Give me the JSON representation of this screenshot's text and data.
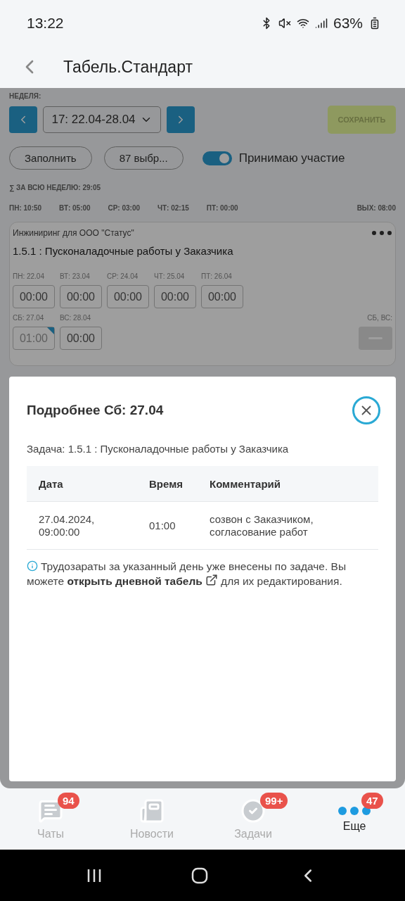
{
  "status_bar": {
    "time": "13:22",
    "battery": "63%"
  },
  "header": {
    "title": "Табель.Стандарт"
  },
  "week": {
    "label": "НЕДЕЛЯ:",
    "selector": "17: 22.04-28.04",
    "save": {
      "label": "СОХРАНИТЬ",
      "disabled": true
    }
  },
  "actions": {
    "fill": "Заполнить",
    "selection": "87 выбр...",
    "toggle": {
      "label": "Принимаю участие",
      "on": true
    }
  },
  "summary": {
    "total": "∑ ЗА ВСЮ НЕДЕЛЮ: 29:05",
    "days": [
      "ПН: 10:50",
      "ВТ: 05:00",
      "СР: 03:00",
      "ЧТ: 02:15",
      "ПТ: 00:00"
    ],
    "weekend": "ВЫХ: 08:00"
  },
  "task_card": {
    "project": "Инжиниринг для ООО \"Статус\"",
    "task": "1.5.1 : Пусконаладочные работы у Заказчика",
    "weekdays": [
      {
        "label": "ПН: 22.04",
        "value": "00:00",
        "commented": false
      },
      {
        "label": "ВТ: 23.04",
        "value": "00:00",
        "commented": false
      },
      {
        "label": "СР: 24.04",
        "value": "00:00",
        "commented": false
      },
      {
        "label": "ЧТ: 25.04",
        "value": "00:00",
        "commented": false
      },
      {
        "label": "ПТ: 26.04",
        "value": "00:00",
        "commented": false
      }
    ],
    "weekend_days": [
      {
        "label": "СБ: 27.04",
        "value": "01:00",
        "commented": true
      },
      {
        "label": "ВС: 28.04",
        "value": "00:00",
        "commented": false
      }
    ],
    "weekend_label": "СБ, ВС:"
  },
  "modal": {
    "title": "Подробнее Сб: 27.04",
    "task": "Задача: 1.5.1 : Пусконаладочные работы у Заказчика",
    "table": {
      "columns": [
        "Дата",
        "Время",
        "Комментарий"
      ],
      "rows": [
        [
          "27.04.2024, 09:00:00",
          "01:00",
          "созвон с Заказчиком, согласование работ"
        ]
      ]
    },
    "note": {
      "before": "Трудозараты за указанный день уже внесены по задаче. Вы можете ",
      "link": "открыть дневной табель",
      "after": " для их редактирования."
    }
  },
  "bottom_nav": {
    "items": [
      {
        "kind": "chat",
        "label": "Чаты",
        "badge": "94",
        "selected": false
      },
      {
        "kind": "news",
        "label": "Новости",
        "selected": false
      },
      {
        "kind": "tasks",
        "label": "Задачи",
        "badge": "99+",
        "selected": false
      },
      {
        "kind": "more",
        "label": "Еще",
        "badge": "47",
        "selected": true
      }
    ]
  }
}
